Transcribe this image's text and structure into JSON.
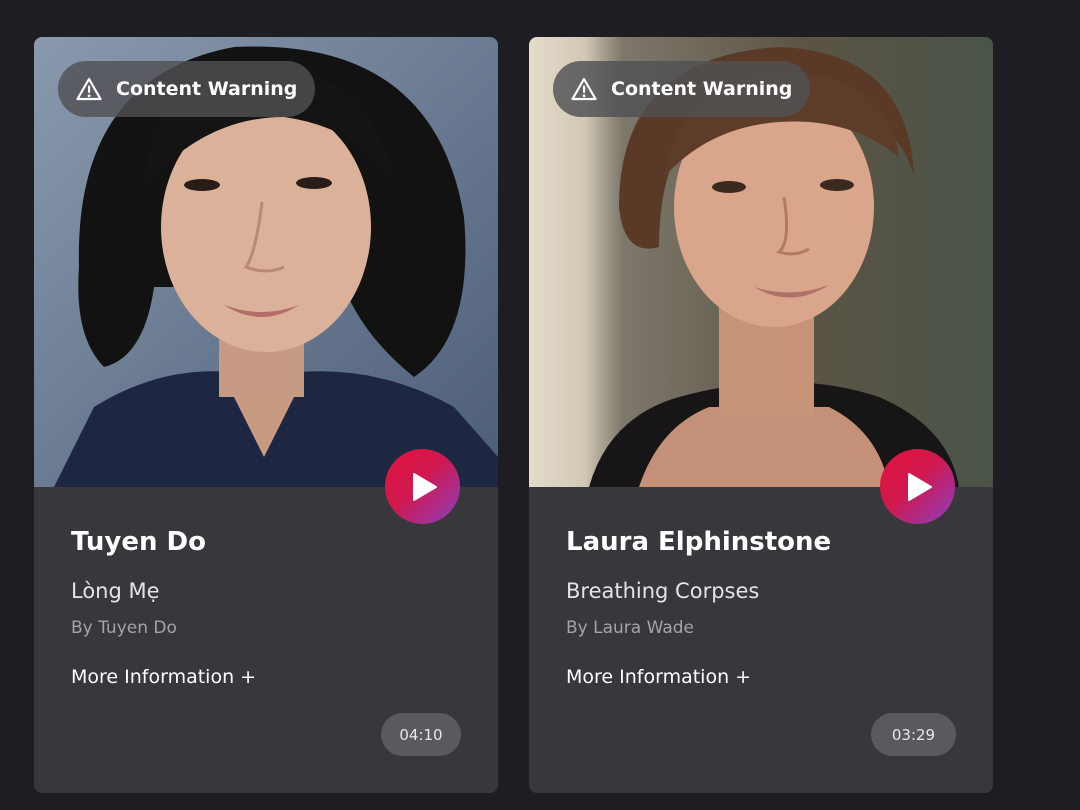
{
  "cards": [
    {
      "badge_label": "Content Warning",
      "name": "Tuyen Do",
      "title": "Lòng Mẹ",
      "author": "By Tuyen Do",
      "more_info": "More Information +",
      "duration": "04:10"
    },
    {
      "badge_label": "Content Warning",
      "name": "Laura Elphinstone",
      "title": "Breathing Corpses",
      "author": "By Laura Wade",
      "more_info": "More Information +",
      "duration": "03:29"
    }
  ],
  "icons": {
    "badge": "warning-triangle-icon",
    "play": "play-icon"
  },
  "colors": {
    "page_background": "#1e1e22",
    "card_background": "#38373c",
    "play_gradient_start": "#e3133b",
    "play_gradient_end": "#8b3fc4",
    "duration_pill": "#5a5a5e"
  }
}
